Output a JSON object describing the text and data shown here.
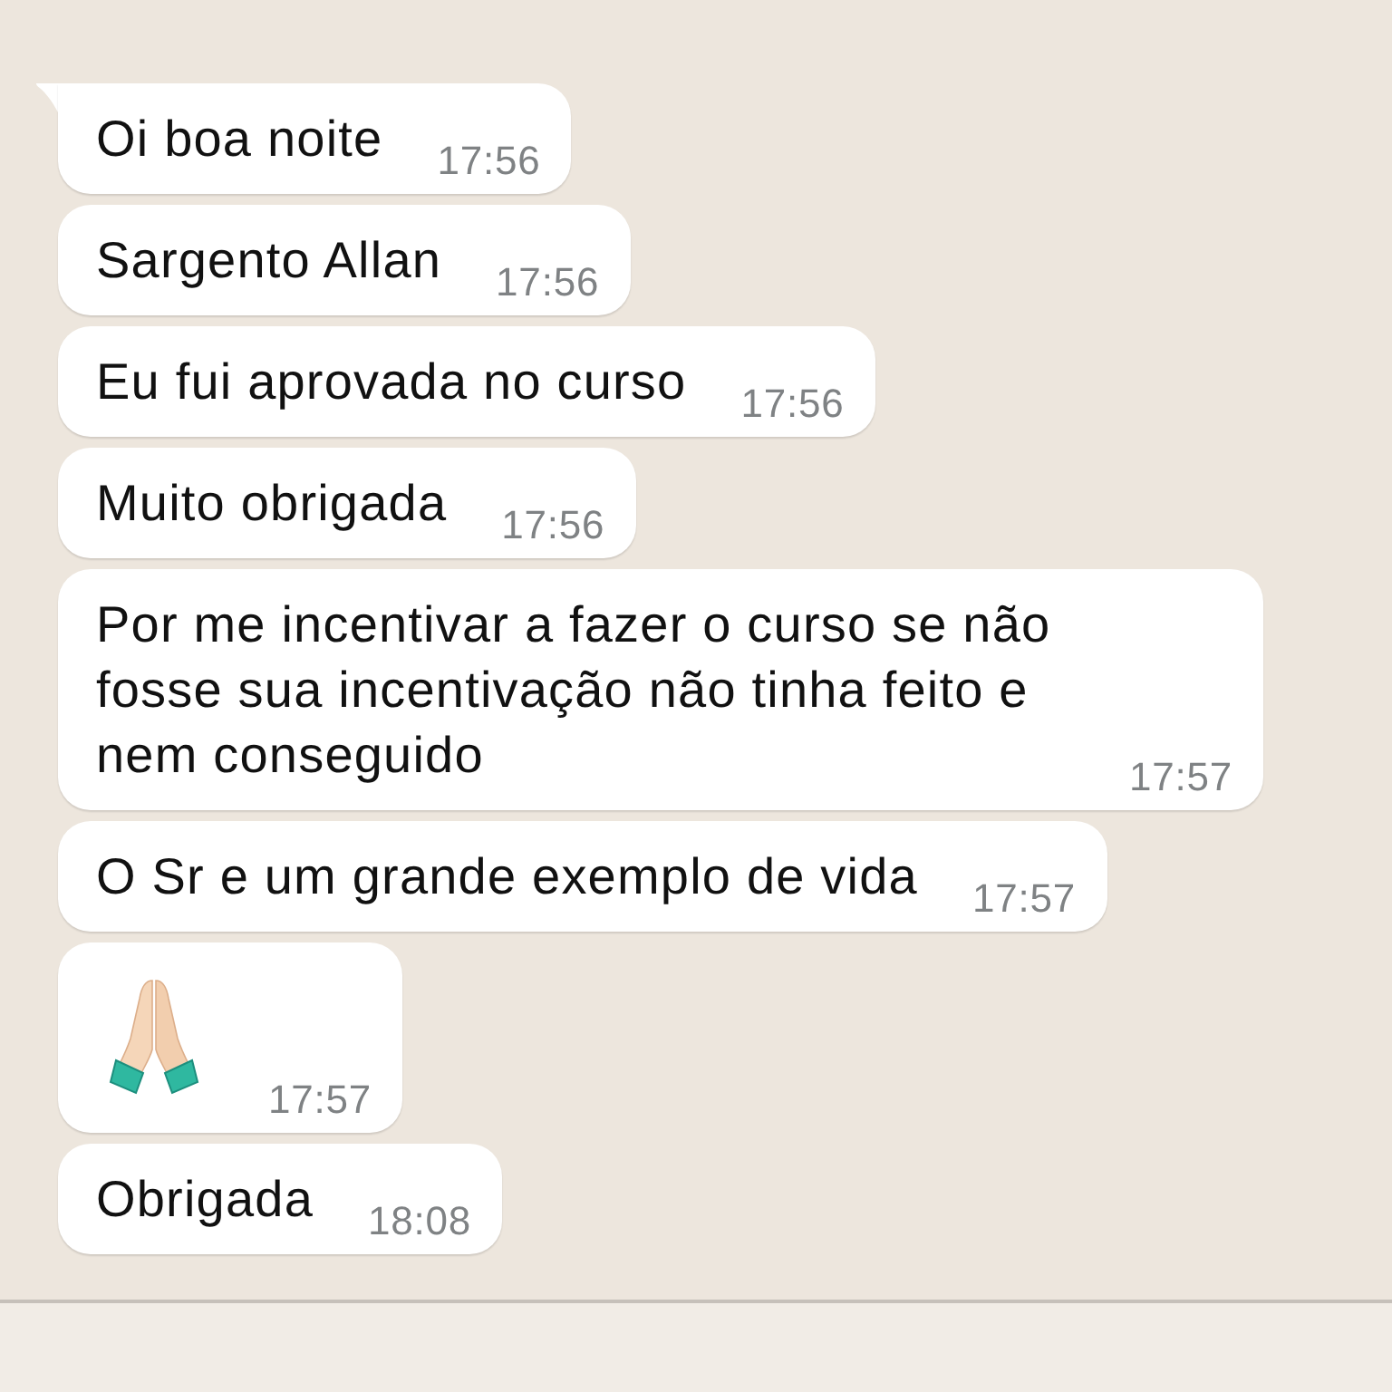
{
  "messages": [
    {
      "kind": "text",
      "text": "Oi boa noite",
      "time": "17:56",
      "tail": true
    },
    {
      "kind": "text",
      "text": "Sargento Allan",
      "time": "17:56",
      "tail": false
    },
    {
      "kind": "text",
      "text": "Eu fui aprovada no curso",
      "time": "17:56",
      "tail": false
    },
    {
      "kind": "text",
      "text": "Muito obrigada",
      "time": "17:56",
      "tail": false
    },
    {
      "kind": "text",
      "text": "Por me incentivar a fazer o curso se não fosse sua incentivação não tinha feito e nem conseguido",
      "time": "17:57",
      "tail": false
    },
    {
      "kind": "text",
      "text": "O Sr e um grande exemplo de vida",
      "time": "17:57",
      "tail": false
    },
    {
      "kind": "emoji",
      "time": "17:57",
      "tail": false
    },
    {
      "kind": "text",
      "text": "Obrigada",
      "time": "18:08",
      "tail": false
    }
  ]
}
